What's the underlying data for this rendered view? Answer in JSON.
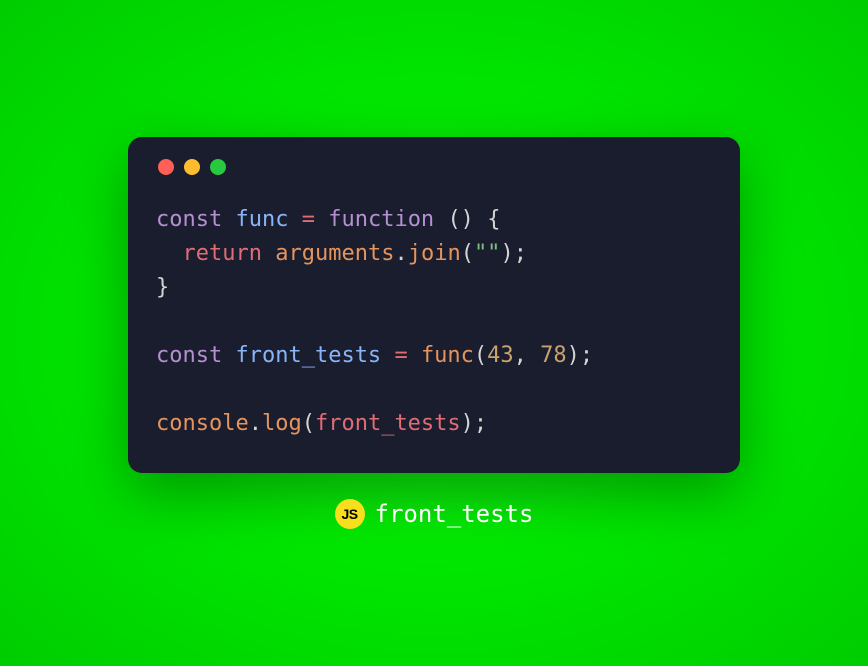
{
  "traffic_lights": {
    "red": "#ff5f56",
    "yellow": "#ffbd2e",
    "green": "#27c93f"
  },
  "code": {
    "line1": {
      "const_kw": "const",
      "sp1": " ",
      "name": "func",
      "sp2": " ",
      "eq": "=",
      "sp3": " ",
      "fn_kw": "function",
      "sp4": " ",
      "parens": "()",
      "sp5": " ",
      "brace_open": "{"
    },
    "line2": {
      "indent": "  ",
      "return_kw": "return",
      "sp1": " ",
      "arguments": "arguments",
      "dot": ".",
      "join": "join",
      "paren_open": "(",
      "str": "\"\"",
      "paren_close": ")",
      "semi": ";"
    },
    "line3": {
      "brace_close": "}"
    },
    "line5": {
      "const_kw": "const",
      "sp1": " ",
      "name": "front_tests",
      "sp2": " ",
      "eq": "=",
      "sp3": " ",
      "call": "func",
      "paren_open": "(",
      "n1": "43",
      "comma": ",",
      "sp4": " ",
      "n2": "78",
      "paren_close": ")",
      "semi": ";"
    },
    "line7": {
      "console": "console",
      "dot": ".",
      "log": "log",
      "paren_open": "(",
      "arg": "front_tests",
      "paren_close": ")",
      "semi": ";"
    }
  },
  "footer": {
    "badge_text": "JS",
    "label": "front_tests"
  }
}
